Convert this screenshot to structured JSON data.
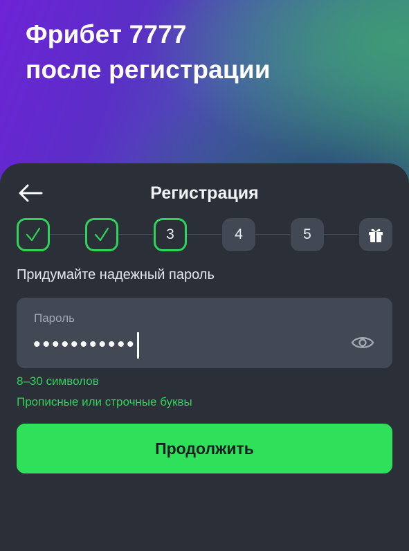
{
  "hero": {
    "line1": "Фрибет 7777",
    "line2": "после регистрации"
  },
  "header": {
    "back_icon": "arrow-left-icon",
    "title": "Регистрация"
  },
  "stepper": {
    "steps": [
      {
        "label": "",
        "state": "done",
        "icon": "check-icon"
      },
      {
        "label": "",
        "state": "done",
        "icon": "check-icon"
      },
      {
        "label": "3",
        "state": "current"
      },
      {
        "label": "4",
        "state": "todo"
      },
      {
        "label": "5",
        "state": "todo"
      },
      {
        "label": "",
        "state": "todo",
        "icon": "gift-icon"
      }
    ]
  },
  "form": {
    "prompt": "Придумайте надежный пароль",
    "password_label": "Пароль",
    "password_value": "•••••••••••",
    "toggle_icon": "eye-icon",
    "hints": [
      "8–30 символов",
      "Прописные или строчные буквы"
    ]
  },
  "actions": {
    "continue_label": "Продолжить"
  },
  "colors": {
    "accent": "#2ee05a",
    "background": "#2b2f38",
    "field": "#434855"
  }
}
